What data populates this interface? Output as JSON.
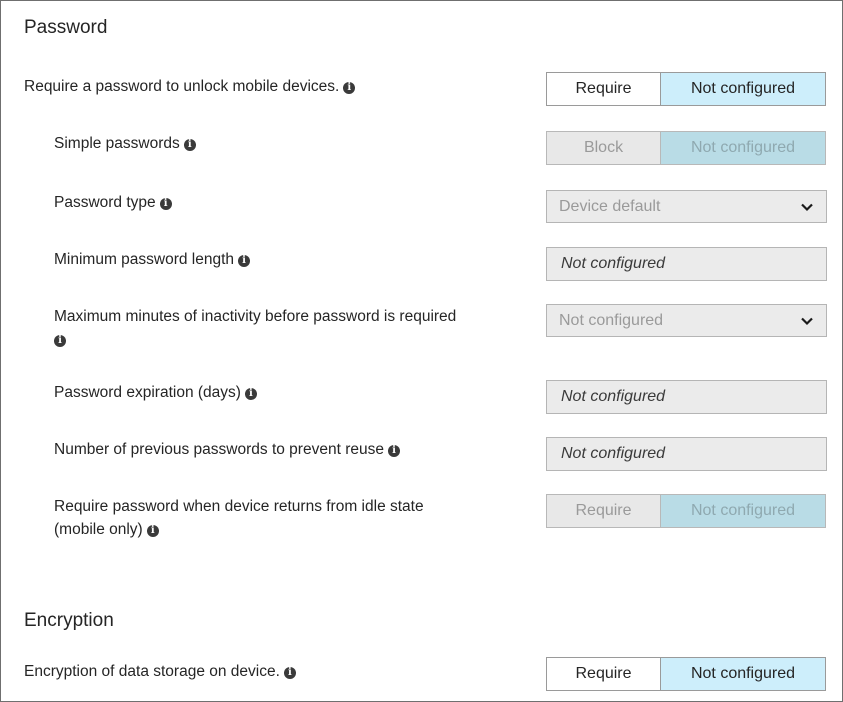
{
  "password": {
    "title": "Password",
    "require_password": {
      "label": "Require a password to unlock mobile devices.",
      "option_a": "Require",
      "option_b": "Not configured",
      "selected": "Not configured"
    },
    "simple_passwords": {
      "label": "Simple passwords",
      "option_a": "Block",
      "option_b": "Not configured",
      "selected": "Not configured"
    },
    "password_type": {
      "label": "Password type",
      "value": "Device default"
    },
    "min_length": {
      "label": "Minimum password length",
      "value": "Not configured"
    },
    "max_inactivity": {
      "label": "Maximum minutes of inactivity before password is required",
      "value": "Not configured"
    },
    "expiration": {
      "label": "Password expiration (days)",
      "value": "Not configured"
    },
    "prevent_reuse": {
      "label": "Number of previous passwords to prevent reuse",
      "value": "Not configured"
    },
    "idle_return": {
      "label_line1": "Require password when device returns from idle state",
      "label_line2": "(mobile only)",
      "option_a": "Require",
      "option_b": "Not configured",
      "selected": "Not configured"
    }
  },
  "encryption": {
    "title": "Encryption",
    "storage": {
      "label": "Encryption of data storage on device.",
      "option_a": "Require",
      "option_b": "Not configured",
      "selected": "Not configured"
    }
  },
  "icons": {
    "info": "info-icon",
    "dropdown": "chevron-down-icon"
  },
  "colors": {
    "selected_bg": "#cdeefb",
    "disabled_selected_bg": "#b9dce6",
    "disabled_field_bg": "#ebebeb"
  }
}
